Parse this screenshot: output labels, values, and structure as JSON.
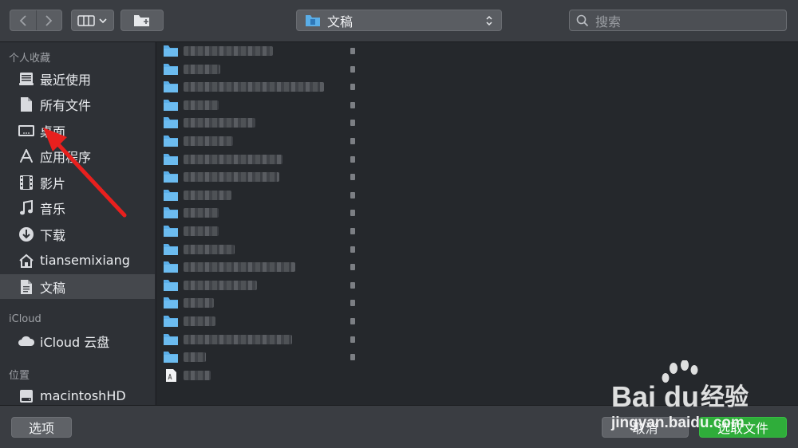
{
  "toolbar": {
    "path_label": "文稿",
    "search_placeholder": "搜索"
  },
  "sidebar": {
    "sections": [
      {
        "title": "个人收藏"
      },
      {
        "title": "iCloud"
      },
      {
        "title": "位置"
      }
    ],
    "favorites": [
      {
        "label": "最近使用",
        "icon": "recents-icon"
      },
      {
        "label": "所有文件",
        "icon": "document-icon"
      },
      {
        "label": "桌面",
        "icon": "desktop-icon"
      },
      {
        "label": "应用程序",
        "icon": "applications-icon"
      },
      {
        "label": "影片",
        "icon": "film-icon"
      },
      {
        "label": "音乐",
        "icon": "music-icon"
      },
      {
        "label": "下载",
        "icon": "download-icon"
      },
      {
        "label": "tiansemixiang",
        "icon": "home-icon"
      },
      {
        "label": "文稿",
        "icon": "documents-icon",
        "selected": true
      }
    ],
    "icloud": [
      {
        "label": "iCloud 云盘",
        "icon": "cloud-icon"
      }
    ],
    "locations": [
      {
        "label": "macintoshHD",
        "icon": "disk-icon"
      }
    ]
  },
  "filelist": {
    "rows": 19,
    "note_blurred": true
  },
  "bottom": {
    "options_label": "选项",
    "cancel_label": "取消",
    "choose_label": "选取文件"
  },
  "watermark": {
    "brand": "Bai du 经验",
    "url": "jingyan.baidu.com"
  },
  "colors": {
    "accent_green": "#2fad3a",
    "annotation_red": "#e8201e",
    "folder_blue": "#5aaee8"
  }
}
